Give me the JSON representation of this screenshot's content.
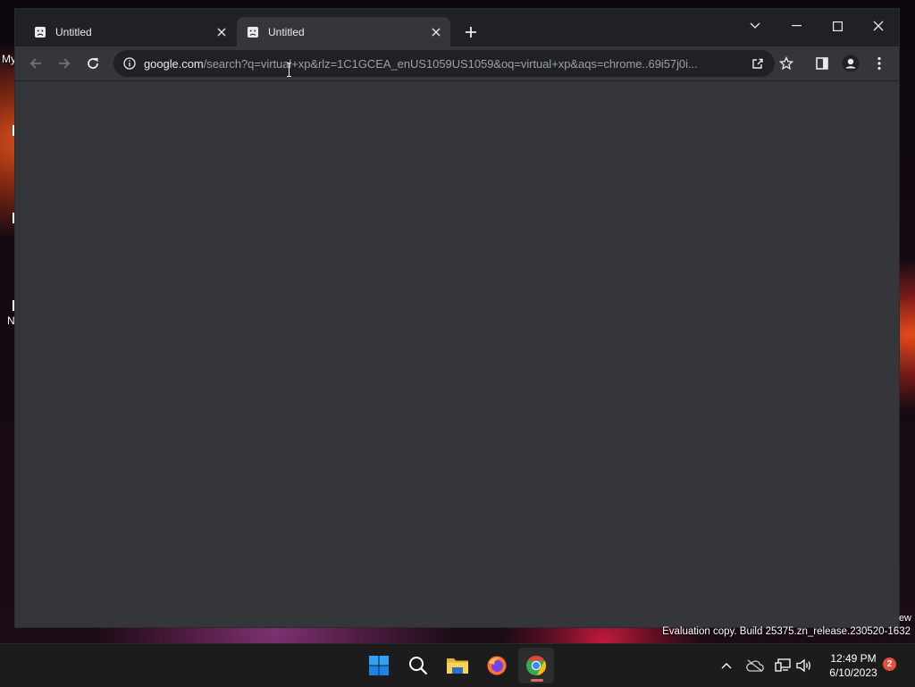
{
  "desktop": {
    "icon_labels": [
      "My",
      "N"
    ],
    "watermark_partial": "ew",
    "evaluation_text": "Evaluation copy. Build 25375.zn_release.230520-1632"
  },
  "browser": {
    "tabs": [
      {
        "label": "Untitled",
        "active": false,
        "icon": "sad-page-icon"
      },
      {
        "label": "Untitled",
        "active": true,
        "icon": "sad-page-icon"
      }
    ],
    "omnibox": {
      "host": "google.com",
      "path": "/search?q=virtual+xp&rlz=1C1GCEA_enUS1059US1059&oq=virtual+xp&aqs=chrome..69i57j0i..."
    },
    "icons": {
      "back": "arrow-left-icon",
      "forward": "arrow-right-icon",
      "reload": "reload-icon",
      "share": "share-icon",
      "bookmark": "star-icon",
      "side_panel": "side-panel-icon",
      "profile": "profile-icon",
      "menu": "kebab-menu-icon"
    }
  },
  "taskbar": {
    "apps": [
      "start",
      "search",
      "file-explorer",
      "firefox",
      "chrome"
    ],
    "active_app": "chrome",
    "clock": {
      "time": "12:49 PM",
      "date": "6/10/2023"
    },
    "notification_count": "2"
  },
  "colors": {
    "window_bg": "#202124",
    "toolbar_bg": "#35363a",
    "accent_windows": "#0078d4"
  }
}
